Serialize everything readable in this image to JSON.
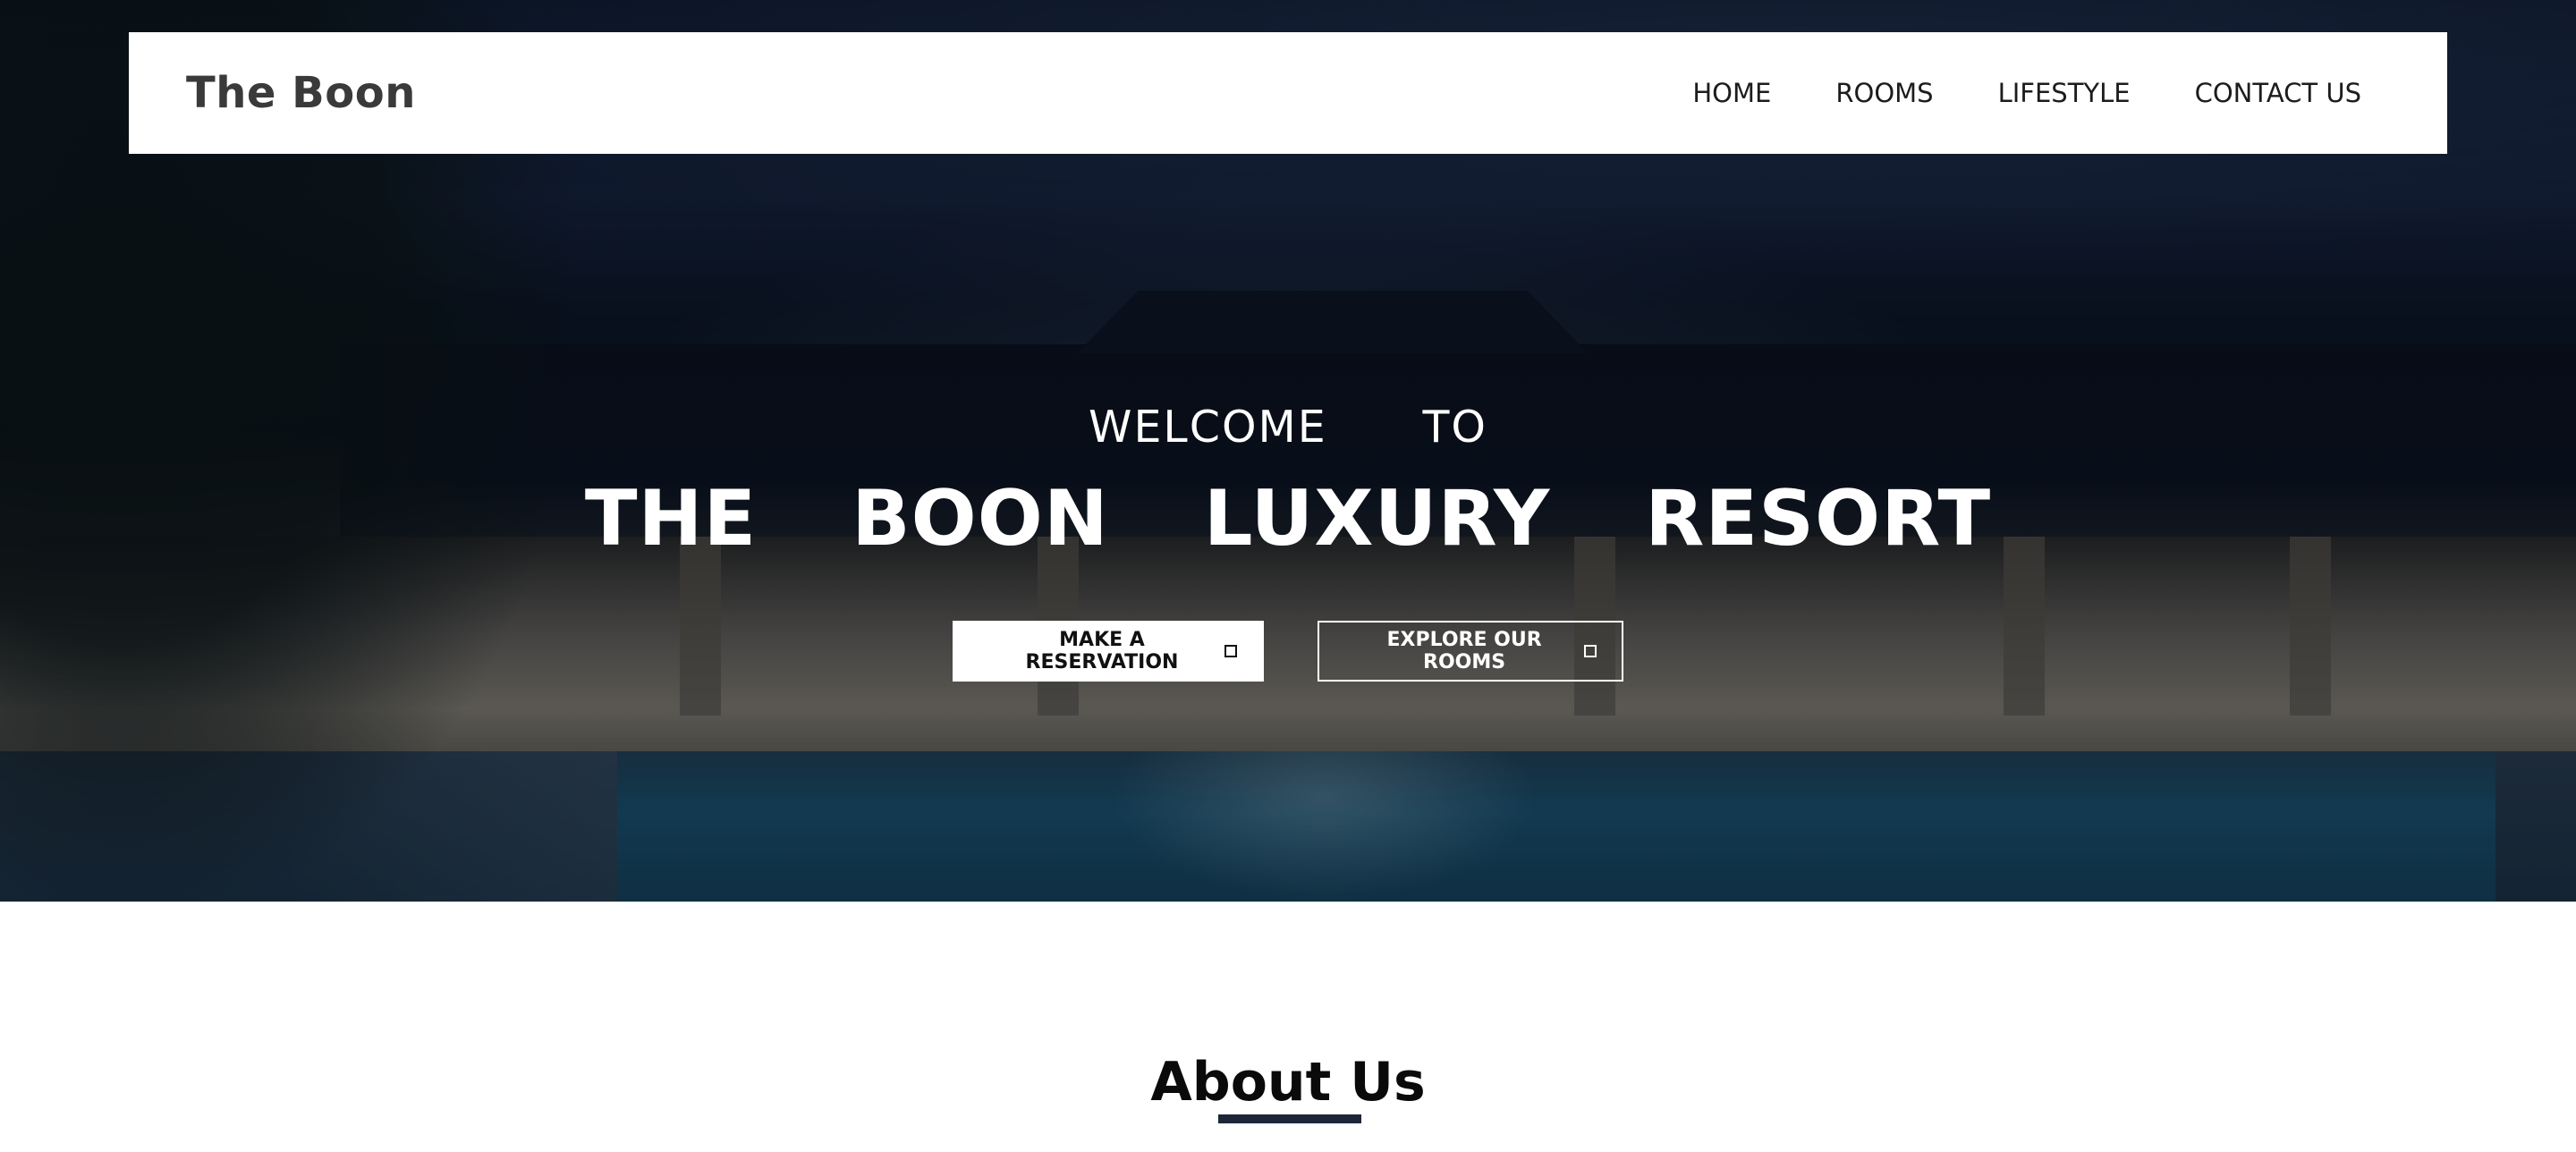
{
  "brand": {
    "name": "The Boon"
  },
  "nav": {
    "items": [
      {
        "label": "HOME"
      },
      {
        "label": "ROOMS"
      },
      {
        "label": "LIFESTYLE"
      },
      {
        "label": "CONTACT US"
      }
    ]
  },
  "hero": {
    "welcome": "WELCOME   TO",
    "headline": "THE  BOON  LUXURY  RESORT",
    "primary_cta": {
      "label": "MAKE A RESERVATION",
      "icon": "square-icon"
    },
    "secondary_cta": {
      "label": "EXPLORE OUR ROOMS",
      "icon": "square-icon"
    }
  },
  "about": {
    "title": "About Us"
  },
  "colors": {
    "overlay": "#040814",
    "nav_background": "#ffffff",
    "brand_text": "#3a3a3a",
    "underline": "#1d2638"
  }
}
